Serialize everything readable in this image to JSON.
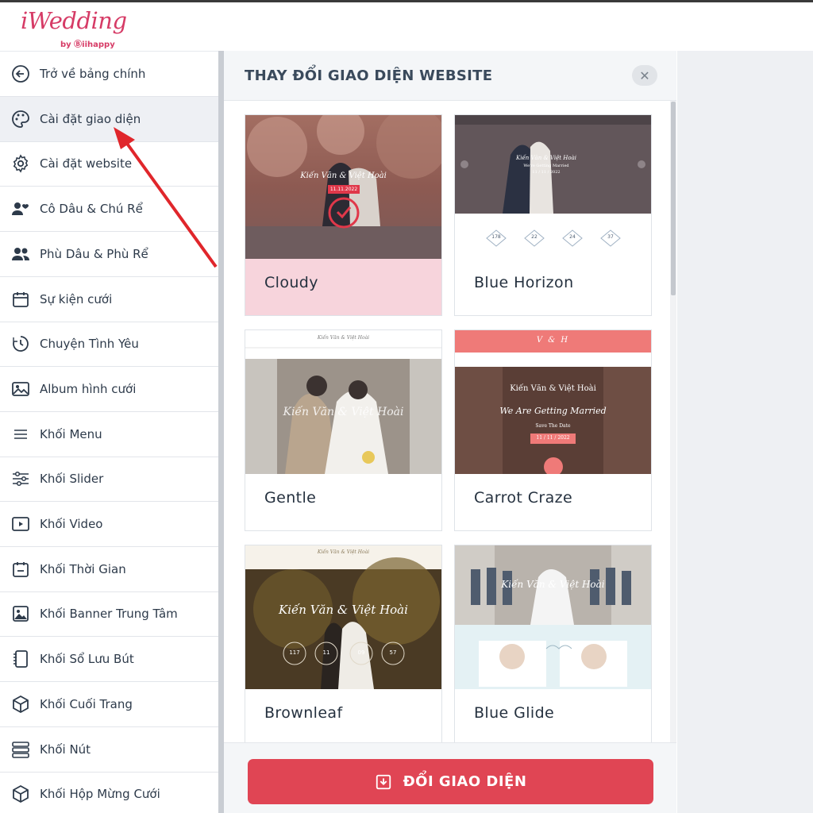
{
  "app": {
    "logo": "iWedding",
    "logo_by": "by Ⓑiihappy"
  },
  "sidebar": {
    "items": [
      {
        "label": "Trở về bảng chính",
        "icon": "arrow-left-circle-icon"
      },
      {
        "label": "Cài đặt giao diện",
        "icon": "palette-icon",
        "active": true
      },
      {
        "label": "Cài đặt website",
        "icon": "gear-icon"
      },
      {
        "label": "Cô Dâu & Chú Rể",
        "icon": "user-heart-icon"
      },
      {
        "label": "Phù Dâu & Phù Rể",
        "icon": "users-icon"
      },
      {
        "label": "Sự kiện cưới",
        "icon": "calendar-icon"
      },
      {
        "label": "Chuyện Tình Yêu",
        "icon": "clock-history-icon"
      },
      {
        "label": "Album hình cưới",
        "icon": "image-icon"
      },
      {
        "label": "Khối Menu",
        "icon": "menu-icon"
      },
      {
        "label": "Khối Slider",
        "icon": "sliders-icon"
      },
      {
        "label": "Khối Video",
        "icon": "video-icon"
      },
      {
        "label": "Khối Thời Gian",
        "icon": "calendar-minus-icon"
      },
      {
        "label": "Khối Banner Trung Tâm",
        "icon": "picture-icon"
      },
      {
        "label": "Khối Sổ Lưu Bút",
        "icon": "notebook-icon"
      },
      {
        "label": "Khối Cuối Trang",
        "icon": "box-icon"
      },
      {
        "label": "Khối Nút",
        "icon": "buttons-icon"
      },
      {
        "label": "Khối Hộp Mừng Cưới",
        "icon": "box-icon"
      }
    ]
  },
  "panel": {
    "title": "THAY ĐỔI GIAO DIỆN WEBSITE",
    "close_icon": "close-icon",
    "themes": [
      {
        "name": "Cloudy",
        "selected": true,
        "preview": {
          "couple": "Kiến Văn & Việt Hoài",
          "date": "11.11.2022"
        }
      },
      {
        "name": "Blue Horizon",
        "selected": false,
        "preview": {
          "couple": "Kiến Văn & Việt Hoài",
          "tagline": "We're Getting Married",
          "date": "11 / 11 / 2022",
          "countdown": [
            "178",
            "22",
            "24",
            "37"
          ]
        }
      },
      {
        "name": "Gentle",
        "selected": false,
        "preview": {
          "couple": "Kiến Văn & Việt Hoài"
        }
      },
      {
        "name": "Carrot Craze",
        "selected": false,
        "preview": {
          "monogram": "V & H",
          "couple": "Kiến Văn & Việt Hoài",
          "tagline": "We Are Getting Married",
          "save": "Save The Date",
          "date": "11 / 11 / 2022"
        }
      },
      {
        "name": "Brownleaf",
        "selected": false,
        "preview": {
          "couple": "Kiến Văn & Việt Hoài",
          "countdown": [
            "117",
            "11",
            "09",
            "57"
          ]
        }
      },
      {
        "name": "Blue Glide",
        "selected": false,
        "preview": {
          "couple": "Kiến Văn & Việt Hoài"
        }
      }
    ],
    "apply_button": "ĐỔI GIAO DIỆN"
  },
  "colors": {
    "brand": "#d63b66",
    "button": "#e04554",
    "selected_card": "#f7d4dc",
    "annotation_arrow": "#e0262b"
  }
}
